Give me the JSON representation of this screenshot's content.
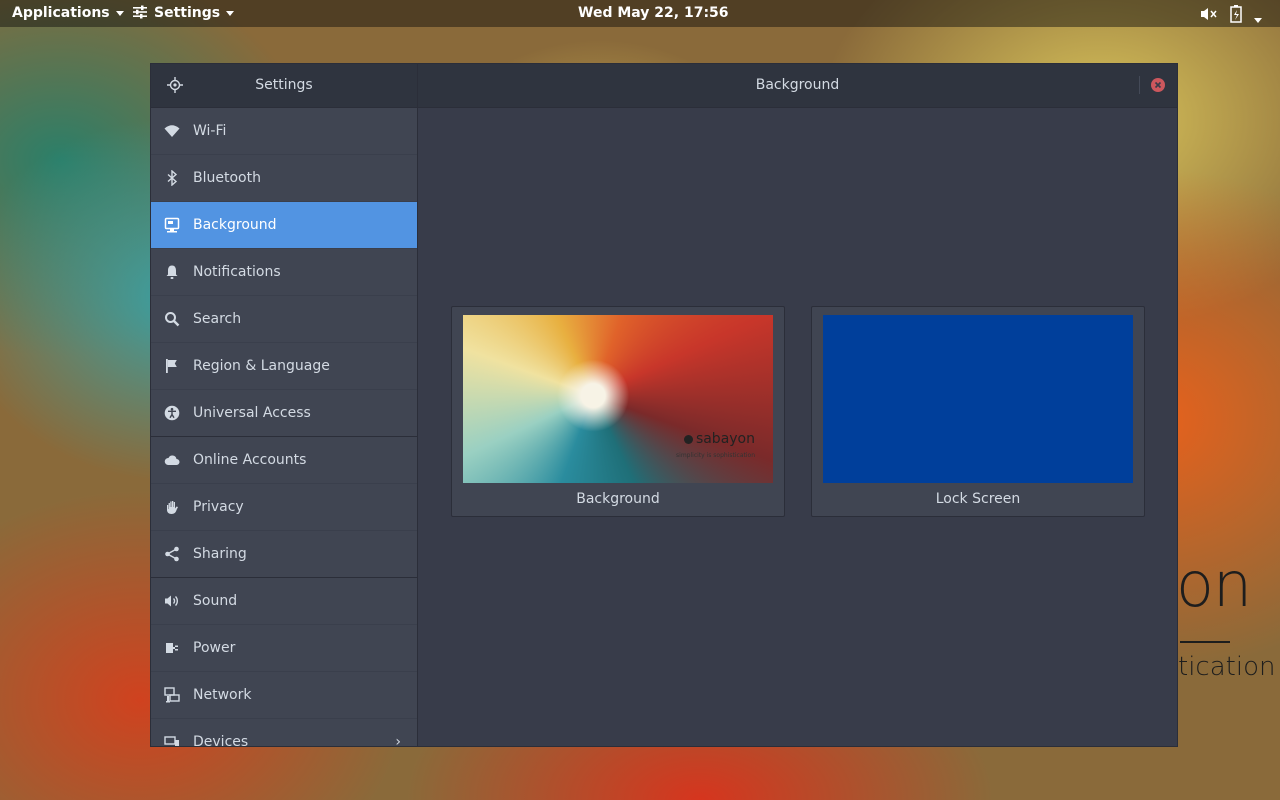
{
  "topbar": {
    "applications_label": "Applications",
    "settings_label": "Settings",
    "clock": "Wed May 22, 17:56",
    "volume_icon": "volume-muted-icon",
    "battery_icon": "battery-charging-icon"
  },
  "desktop": {
    "logo_text": "on",
    "tagline_text": "tication"
  },
  "window": {
    "sidebar_title": "Settings",
    "page_title": "Background",
    "close_icon": "close-icon"
  },
  "sidebar": {
    "items": [
      {
        "label": "Wi-Fi",
        "icon": "wifi-icon"
      },
      {
        "label": "Bluetooth",
        "icon": "bluetooth-icon"
      },
      {
        "label": "Background",
        "icon": "background-icon",
        "active": true
      },
      {
        "label": "Notifications",
        "icon": "bell-icon"
      },
      {
        "label": "Search",
        "icon": "search-icon"
      },
      {
        "label": "Region & Language",
        "icon": "flag-icon"
      },
      {
        "label": "Universal Access",
        "icon": "accessibility-icon"
      },
      {
        "label": "Online Accounts",
        "icon": "cloud-icon"
      },
      {
        "label": "Privacy",
        "icon": "hand-icon"
      },
      {
        "label": "Sharing",
        "icon": "share-icon"
      },
      {
        "label": "Sound",
        "icon": "speaker-icon"
      },
      {
        "label": "Power",
        "icon": "power-icon"
      },
      {
        "label": "Network",
        "icon": "network-icon"
      },
      {
        "label": "Devices",
        "icon": "devices-icon"
      }
    ]
  },
  "content": {
    "cards": [
      {
        "label": "Background",
        "thumb_logo": "sabayon",
        "thumb_tagline": "simplicity is sophistication"
      },
      {
        "label": "Lock Screen",
        "thumb_color": "#003f9b"
      }
    ]
  },
  "colors": {
    "accent": "#5294e2",
    "window_bg": "#383c4a",
    "sidebar_bg": "#404552",
    "close": "#cc575d"
  }
}
